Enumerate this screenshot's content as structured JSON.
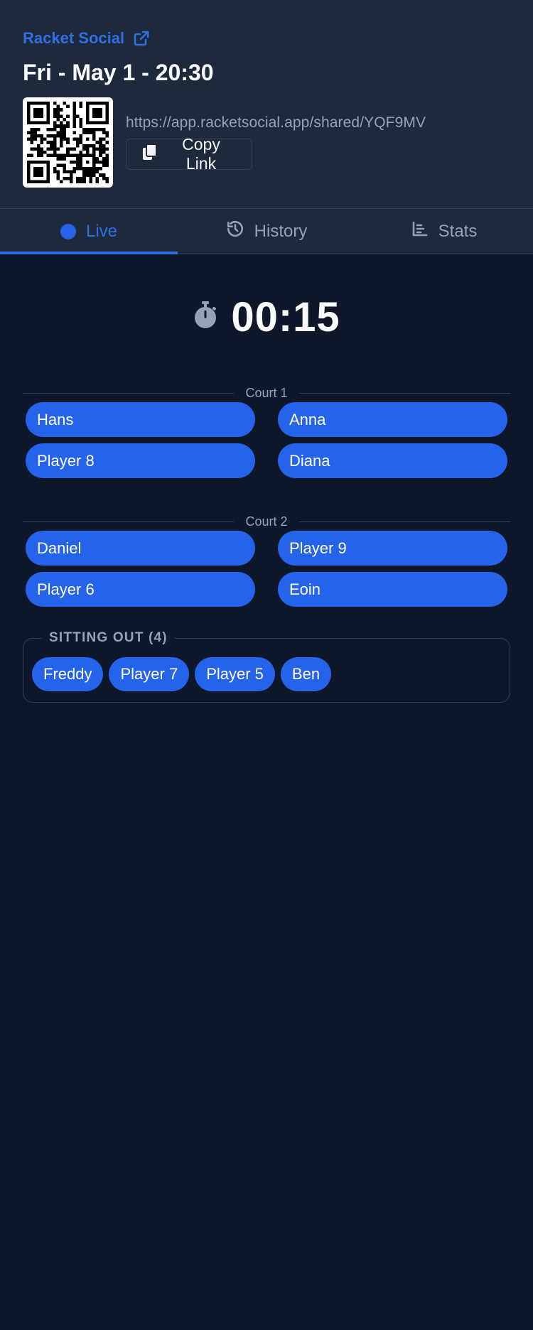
{
  "header": {
    "brand": "Racket Social",
    "session_title": "Fri - May 1 - 20:30",
    "share_url": "https://app.racketsocial.app/shared/YQF9MV",
    "copy_label": "Copy Link"
  },
  "tabs": [
    {
      "label": "Live",
      "icon": "live-dot-icon",
      "active": true
    },
    {
      "label": "History",
      "icon": "history-icon",
      "active": false
    },
    {
      "label": "Stats",
      "icon": "stats-icon",
      "active": false
    }
  ],
  "timer": {
    "value": "00:15",
    "icon": "stopwatch-icon"
  },
  "courts": [
    {
      "label": "Court 1",
      "team_a": [
        "Hans",
        "Player 8"
      ],
      "team_b": [
        "Anna",
        "Diana"
      ]
    },
    {
      "label": "Court 2",
      "team_a": [
        "Daniel",
        "Player 6"
      ],
      "team_b": [
        "Player 9",
        "Eoin"
      ]
    }
  ],
  "sitting_out": {
    "label": "SITTING OUT (4)",
    "players": [
      "Freddy",
      "Player 7",
      "Player 5",
      "Ben"
    ]
  },
  "colors": {
    "accent": "#2563eb",
    "background": "#0f172a",
    "panel": "#1e293b",
    "muted_text": "#94a3b8"
  }
}
